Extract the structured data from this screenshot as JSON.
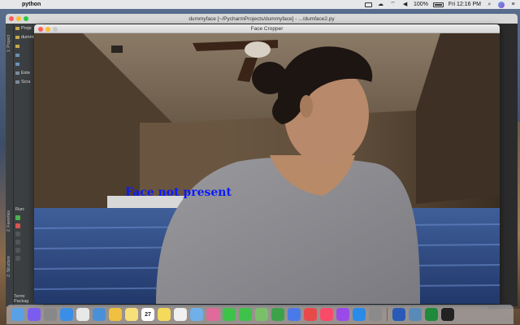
{
  "menubar": {
    "app_name": "python",
    "battery": "100%",
    "clock": "Fri 12:16 PM"
  },
  "ide": {
    "title": "dummyface [~/PycharmProjects/dummyface] - .../dumface2.py",
    "tree": [
      "Proje",
      "dummy",
      "",
      "",
      "",
      "Exte",
      "Scra"
    ],
    "side_tabs": [
      "1: Project",
      "2: Structure",
      "2: Favorites"
    ],
    "run_label": "Run:",
    "terminal_label": "Termi",
    "packages_label": "Packag"
  },
  "face_cropper": {
    "title": "Face Cropper",
    "overlay_text": "Face not present",
    "overlay_color": "#0a1aff"
  },
  "dock": {
    "items": [
      "finder-icon",
      "siri-icon",
      "launchpad-icon",
      "safari-icon",
      "chrome-icon",
      "mail-icon",
      "photos-icon",
      "notes-icon",
      "calendar-icon",
      "stickies-icon",
      "reminders-icon",
      "preview-icon",
      "photos-app-icon",
      "messages-icon",
      "facetime-icon",
      "maps-icon",
      "numbers-icon",
      "keynote-icon",
      "news-icon",
      "music-icon",
      "podcasts-icon",
      "appstore-icon",
      "system-prefs-icon",
      "word-icon",
      "image-capture-icon",
      "pycharm-icon",
      "terminal-icon"
    ],
    "calendar_day": "27"
  }
}
